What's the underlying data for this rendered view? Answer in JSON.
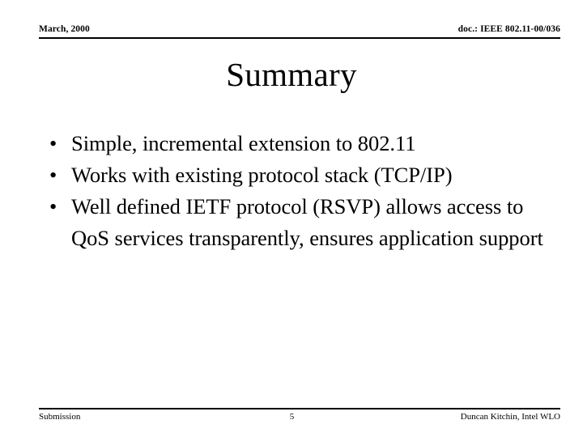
{
  "slide": {
    "header": {
      "date": "March, 2000",
      "document": "doc.: IEEE 802.11-00/036"
    },
    "title": "Summary",
    "bullets": [
      {
        "marker": "•",
        "text": "Simple, incremental extension to 802.11"
      },
      {
        "marker": "•",
        "text": "Works with existing protocol stack (TCP/IP)"
      },
      {
        "marker": "•",
        "text": "Well defined IETF protocol (RSVP) allows access to QoS services transparently, ensures application support"
      }
    ],
    "footer": {
      "left": "Submission",
      "page_number": "5",
      "right": "Duncan Kitchin, Intel WLO"
    },
    "colors": {
      "background": "#ffffff",
      "text": "#000000",
      "rule": "#000000"
    }
  }
}
